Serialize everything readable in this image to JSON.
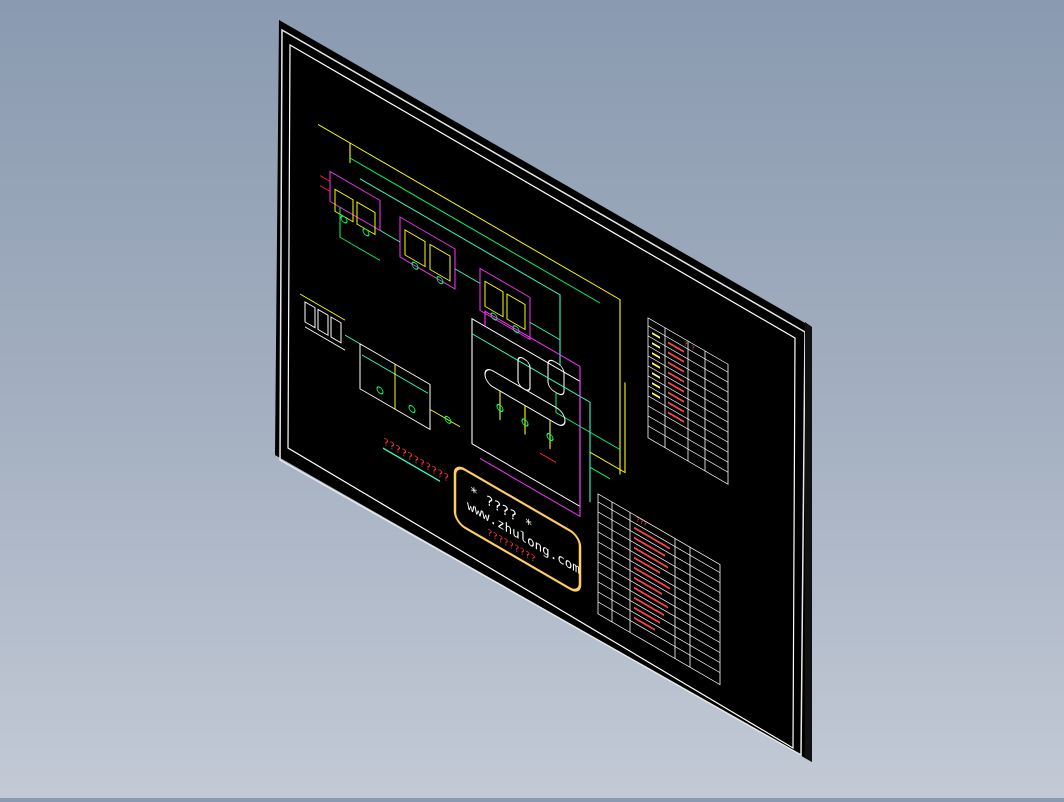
{
  "stamp": {
    "line1": "* ???? *",
    "line2": "www.zhulong.com",
    "line3": "?????????"
  },
  "diagram_caption": "???????????",
  "tables": {
    "upper_header": "? ?",
    "lower_header": "???"
  },
  "colors": {
    "background_top": "#8a9ab0",
    "background_bottom": "#c3cad6",
    "sheet": "#000000",
    "frame": "#ffffff",
    "pipe_green": "#00ff66",
    "pipe_yellow": "#ffff00",
    "pipe_magenta": "#ff33ff",
    "pipe_cyan": "#33ffcc",
    "pipe_red": "#ff2222",
    "stamp_border": "#ffcc66"
  }
}
